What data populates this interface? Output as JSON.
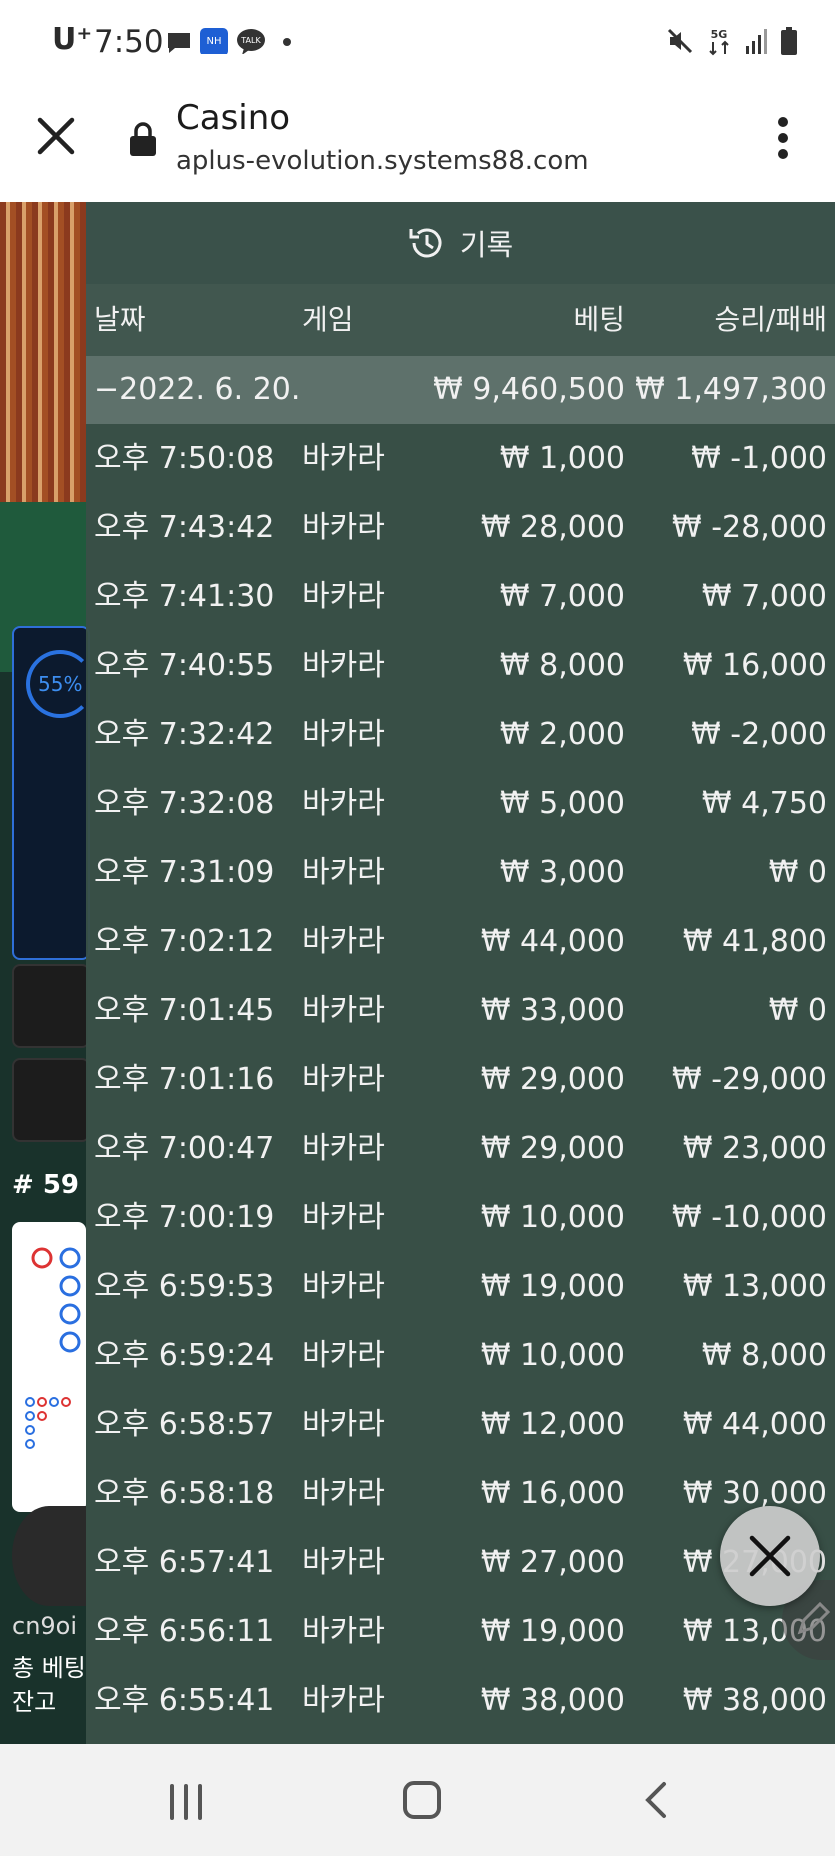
{
  "status_bar": {
    "carrier": "U⁺",
    "time": "7:50",
    "icons": [
      "message-icon",
      "nh-bank-icon",
      "kakaotalk-icon",
      "dot-icon",
      "mute-icon",
      "5g-icon",
      "signal-icon",
      "battery-icon"
    ]
  },
  "browser": {
    "title": "Casino",
    "url": "aplus-evolution.systems88.com"
  },
  "background_page": {
    "percent": "55%",
    "round_label": "# 59",
    "username": "cn9oi",
    "total_bet_label": "총 베팅",
    "balance_label": "잔고"
  },
  "history": {
    "header": "기록",
    "columns": {
      "date": "날짜",
      "game": "게임",
      "bet": "베팅",
      "result": "승리/패배"
    },
    "summary": {
      "date": "−2022. 6. 20.",
      "bet": "₩ 9,460,500",
      "result": "₩ 1,497,300"
    },
    "rows": [
      {
        "time": "오후 7:50:08",
        "game": "바카라",
        "bet": "₩ 1,000",
        "result": "₩ -1,000"
      },
      {
        "time": "오후 7:43:42",
        "game": "바카라",
        "bet": "₩ 28,000",
        "result": "₩ -28,000"
      },
      {
        "time": "오후 7:41:30",
        "game": "바카라",
        "bet": "₩ 7,000",
        "result": "₩ 7,000"
      },
      {
        "time": "오후 7:40:55",
        "game": "바카라",
        "bet": "₩ 8,000",
        "result": "₩ 16,000"
      },
      {
        "time": "오후 7:32:42",
        "game": "바카라",
        "bet": "₩ 2,000",
        "result": "₩ -2,000"
      },
      {
        "time": "오후 7:32:08",
        "game": "바카라",
        "bet": "₩ 5,000",
        "result": "₩ 4,750"
      },
      {
        "time": "오후 7:31:09",
        "game": "바카라",
        "bet": "₩ 3,000",
        "result": "₩ 0"
      },
      {
        "time": "오후 7:02:12",
        "game": "바카라",
        "bet": "₩ 44,000",
        "result": "₩ 41,800"
      },
      {
        "time": "오후 7:01:45",
        "game": "바카라",
        "bet": "₩ 33,000",
        "result": "₩ 0"
      },
      {
        "time": "오후 7:01:16",
        "game": "바카라",
        "bet": "₩ 29,000",
        "result": "₩ -29,000"
      },
      {
        "time": "오후 7:00:47",
        "game": "바카라",
        "bet": "₩ 29,000",
        "result": "₩ 23,000"
      },
      {
        "time": "오후 7:00:19",
        "game": "바카라",
        "bet": "₩ 10,000",
        "result": "₩ -10,000"
      },
      {
        "time": "오후 6:59:53",
        "game": "바카라",
        "bet": "₩ 19,000",
        "result": "₩ 13,000"
      },
      {
        "time": "오후 6:59:24",
        "game": "바카라",
        "bet": "₩ 10,000",
        "result": "₩ 8,000"
      },
      {
        "time": "오후 6:58:57",
        "game": "바카라",
        "bet": "₩ 12,000",
        "result": "₩ 44,000"
      },
      {
        "time": "오후 6:58:18",
        "game": "바카라",
        "bet": "₩ 16,000",
        "result": "₩ 30,000"
      },
      {
        "time": "오후 6:57:41",
        "game": "바카라",
        "bet": "₩ 27,000",
        "result": "₩ 27,000"
      },
      {
        "time": "오후 6:56:11",
        "game": "바카라",
        "bet": "₩ 19,000",
        "result": "₩ 13,000"
      },
      {
        "time": "오후 6:55:41",
        "game": "바카라",
        "bet": "₩ 38,000",
        "result": "₩ 38,000"
      }
    ]
  },
  "colors": {
    "overlay": "#3a514a",
    "summary_row": "#5e716b",
    "text": "#f1f1f1"
  }
}
